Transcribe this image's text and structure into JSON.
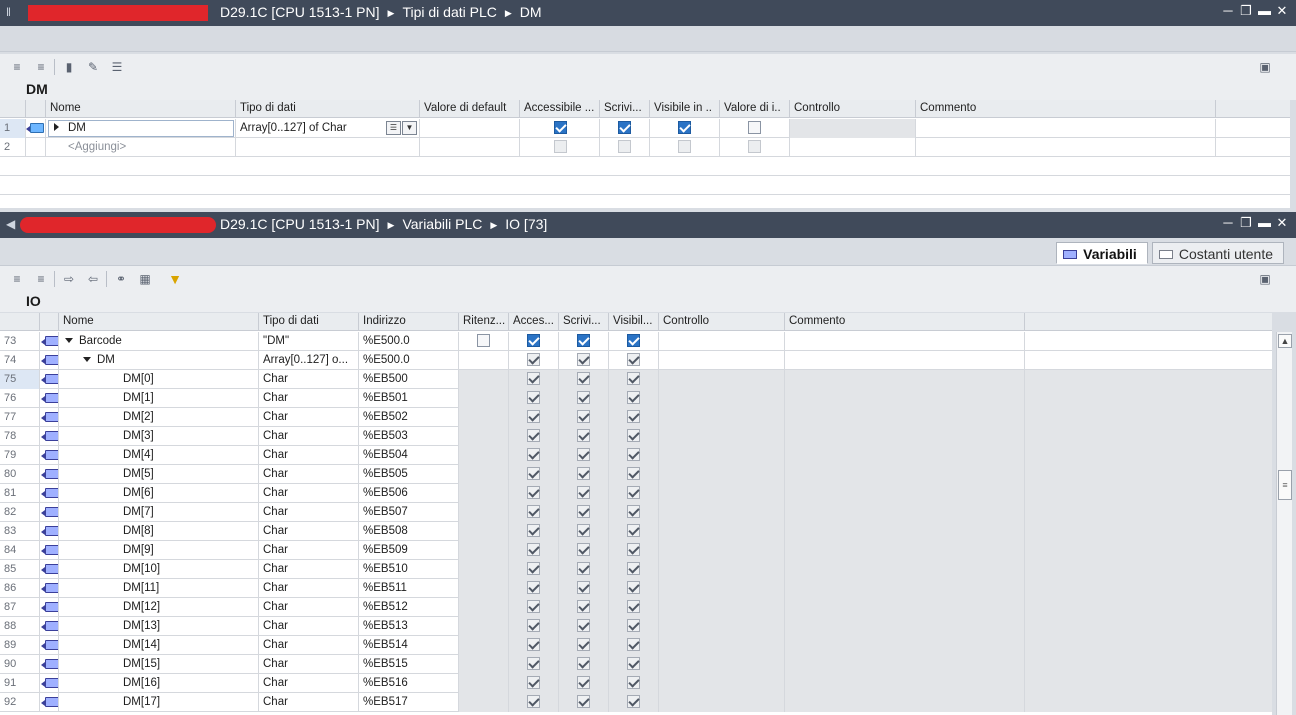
{
  "top_window": {
    "breadcrumb": [
      "D29.1C [CPU 1513-1 PN]",
      "Tipi di dati PLC",
      "DM"
    ]
  },
  "top_editor": {
    "title": "DM",
    "columns": [
      "Nome",
      "Tipo di dati",
      "Valore di default",
      "Accessibile ...",
      "Scrivi...",
      "Visibile in ..",
      "Valore di i..",
      "Controllo",
      "Commento"
    ],
    "rows": [
      {
        "num": "1",
        "name": "DM",
        "type": "Array[0..127] of Char",
        "acc": true,
        "wri": true,
        "vis": true,
        "init": false
      },
      {
        "num": "2",
        "name": "<Aggiungi>"
      }
    ]
  },
  "bottom_window": {
    "breadcrumb": [
      "D29.1C [CPU 1513-1 PN]",
      "Variabili PLC",
      "IO [73]"
    ]
  },
  "bottom_tabs": {
    "variabili": "Variabili",
    "costanti": "Costanti utente"
  },
  "bottom_editor": {
    "title": "IO",
    "columns": [
      "Nome",
      "Tipo di dati",
      "Indirizzo",
      "Ritenz...",
      "Acces...",
      "Scrivi...",
      "Visibil...",
      "Controllo",
      "Commento"
    ],
    "rows": [
      {
        "num": "73",
        "name": "Barcode",
        "type": "\"DM\"",
        "addr": "%E500.0",
        "level": 0,
        "expand": true
      },
      {
        "num": "74",
        "name": "DM",
        "type": "Array[0..127] o...",
        "addr": "%E500.0",
        "level": 1,
        "expand": true
      },
      {
        "num": "75",
        "name": "DM[0]",
        "type": "Char",
        "addr": "%EB500",
        "level": 2
      },
      {
        "num": "76",
        "name": "DM[1]",
        "type": "Char",
        "addr": "%EB501",
        "level": 2
      },
      {
        "num": "77",
        "name": "DM[2]",
        "type": "Char",
        "addr": "%EB502",
        "level": 2
      },
      {
        "num": "78",
        "name": "DM[3]",
        "type": "Char",
        "addr": "%EB503",
        "level": 2
      },
      {
        "num": "79",
        "name": "DM[4]",
        "type": "Char",
        "addr": "%EB504",
        "level": 2
      },
      {
        "num": "80",
        "name": "DM[5]",
        "type": "Char",
        "addr": "%EB505",
        "level": 2
      },
      {
        "num": "81",
        "name": "DM[6]",
        "type": "Char",
        "addr": "%EB506",
        "level": 2
      },
      {
        "num": "82",
        "name": "DM[7]",
        "type": "Char",
        "addr": "%EB507",
        "level": 2
      },
      {
        "num": "83",
        "name": "DM[8]",
        "type": "Char",
        "addr": "%EB508",
        "level": 2
      },
      {
        "num": "84",
        "name": "DM[9]",
        "type": "Char",
        "addr": "%EB509",
        "level": 2
      },
      {
        "num": "85",
        "name": "DM[10]",
        "type": "Char",
        "addr": "%EB510",
        "level": 2
      },
      {
        "num": "86",
        "name": "DM[11]",
        "type": "Char",
        "addr": "%EB511",
        "level": 2
      },
      {
        "num": "87",
        "name": "DM[12]",
        "type": "Char",
        "addr": "%EB512",
        "level": 2
      },
      {
        "num": "88",
        "name": "DM[13]",
        "type": "Char",
        "addr": "%EB513",
        "level": 2
      },
      {
        "num": "89",
        "name": "DM[14]",
        "type": "Char",
        "addr": "%EB514",
        "level": 2
      },
      {
        "num": "90",
        "name": "DM[15]",
        "type": "Char",
        "addr": "%EB515",
        "level": 2
      },
      {
        "num": "91",
        "name": "DM[16]",
        "type": "Char",
        "addr": "%EB516",
        "level": 2
      },
      {
        "num": "92",
        "name": "DM[17]",
        "type": "Char",
        "addr": "%EB517",
        "level": 2
      }
    ]
  },
  "colors": {
    "titlebar": "#404a5a",
    "checkbox_on": "#2a73c5",
    "redaction": "#e0262b"
  }
}
